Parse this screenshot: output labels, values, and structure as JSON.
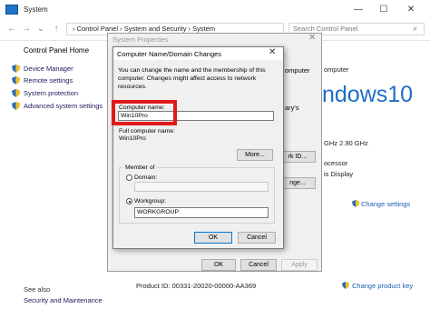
{
  "window": {
    "title": "System",
    "controls": {
      "minimize": "—",
      "maximize": "☐",
      "close": "✕"
    }
  },
  "address": {
    "path": "›  Control Panel  ›  System and Security  ›  System",
    "search_placeholder": "Search Control Panel"
  },
  "sidebar": {
    "home": "Control Panel Home",
    "items": [
      {
        "label": "Device Manager",
        "icon": "shield-icon"
      },
      {
        "label": "Remote settings",
        "icon": "shield-icon"
      },
      {
        "label": "System protection",
        "icon": "shield-icon"
      },
      {
        "label": "Advanced system settings",
        "icon": "shield-icon"
      }
    ],
    "see_also": "See also",
    "security_maintenance": "Security and Maintenance"
  },
  "background": {
    "windows_logo_text": "ndows10",
    "peek_computer": "omputer",
    "peek_ary": "ary's",
    "peek_ghz": "GHz   2.90 GHz",
    "peek_processor": "ocessor",
    "peek_display": "is Display",
    "change_settings": "Change settings",
    "change_product_key": "Change product key",
    "product_id": "Product ID:  00331-20020-00000-AA369"
  },
  "system_properties": {
    "title": "System Properties",
    "close": "✕",
    "network_id_button": "rk ID...",
    "change_button": "nge...",
    "ok": "OK",
    "cancel": "Cancel",
    "apply": "Apply"
  },
  "name_change": {
    "title": "Computer Name/Domain Changes",
    "close": "✕",
    "description": "You can change the name and the membership of this computer. Changes might affect access to network resources.",
    "computer_name_label": "Computer name:",
    "computer_name_value": "Win10Pro",
    "full_name_label": "Full computer name:",
    "full_name_value": "Win10Pro",
    "more_button": "More...",
    "member_of": "Member of",
    "domain_label": "Domain:",
    "domain_value": "",
    "workgroup_label": "Workgroup:",
    "workgroup_value": "WORKGROUP",
    "selected_membership": "Workgroup",
    "ok": "OK",
    "cancel": "Cancel"
  },
  "colors": {
    "highlight": "#e01a1a",
    "accent": "#0078d7",
    "windows_logo": "#1e6fc8"
  }
}
